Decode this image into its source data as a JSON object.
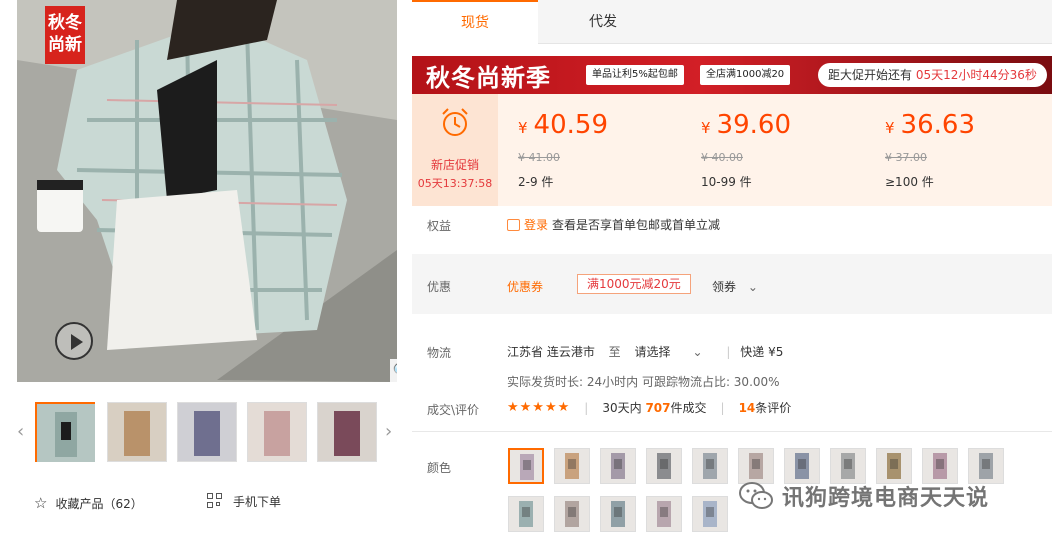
{
  "gallery": {
    "badge_text": "秋冬尚新",
    "play_icon": "play-icon",
    "zoom_icon": "magnifier-icon",
    "thumb_colors": [
      "#a9b9b4",
      "#b9926a",
      "#6f6f8f",
      "#c8a2a0",
      "#7a4a5a"
    ]
  },
  "favorite": {
    "label": "收藏产品（62）"
  },
  "mobile_order": {
    "label": "手机下单"
  },
  "tabs": [
    {
      "label": "现货"
    },
    {
      "label": "代发"
    }
  ],
  "promo": {
    "title": "秋冬尚新季",
    "tag1": "单品让利5%起包邮",
    "tag2": "全店满1000减20",
    "countdown_prefix": "距大促开始还有",
    "countdown_time": "05天12小时44分36秒"
  },
  "new_store": {
    "label": "新店促销",
    "time": "05天13:37:58"
  },
  "tiers": [
    {
      "currency": "¥",
      "price": "40.59",
      "original": "¥ 41.00",
      "range": "2-9 件"
    },
    {
      "currency": "¥",
      "price": "39.60",
      "original": "¥ 40.00",
      "range": "10-99 件"
    },
    {
      "currency": "¥",
      "price": "36.63",
      "original": "¥ 37.00",
      "range": "≥100 件"
    }
  ],
  "rights": {
    "label": "权益",
    "login": "登录",
    "text": "查看是否享首单包邮或首单立减"
  },
  "discount": {
    "label": "优惠",
    "coupon_label": "优惠券",
    "coupon": "满1000元减20元",
    "get": "领券"
  },
  "shipping": {
    "label": "物流",
    "from": "江苏省 连云港市",
    "to": "至",
    "select": "请选择",
    "method": "快递 ¥5",
    "sub": "实际发货时长: 24小时内   可跟踪物流占比: 30.00%"
  },
  "deals": {
    "label": "成交\\评价",
    "stars": "★★★★★",
    "days": "30天内",
    "count": "707",
    "count_suffix": "件成交",
    "reviews": "14",
    "reviews_suffix": "条评价"
  },
  "color": {
    "label": "颜色",
    "swatches": [
      "#b9a8b8",
      "#c9a27e",
      "#a49aa8",
      "#8b8c8f",
      "#9fa6ac",
      "#b7a7a3",
      "#8a93a6",
      "#a7a8a8",
      "#a8926e",
      "#b89aa8",
      "#9ea3a8",
      "#9bb0b0",
      "#b2a5a0",
      "#90a0a6",
      "#b8a6ae",
      "#a9b5c9"
    ]
  },
  "watermark": {
    "text": "讯狗跨境电商天天说"
  },
  "colors": {
    "accent": "#ff6a00",
    "price": "#ff4400",
    "banner_red": "#d21f26"
  }
}
